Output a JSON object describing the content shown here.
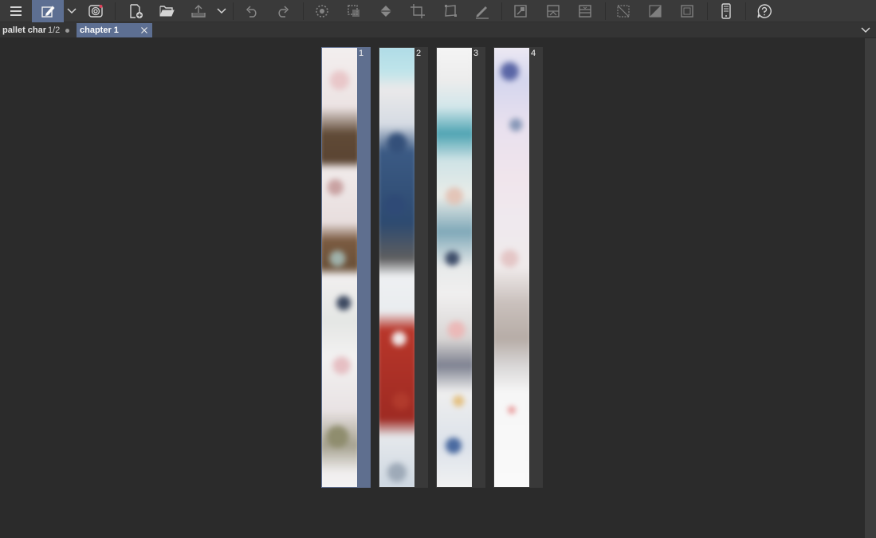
{
  "toolbar": {
    "buttons": [
      {
        "name": "menu-button",
        "icon": "hamburger-icon"
      },
      {
        "name": "edit-mode-button",
        "icon": "pencil-page-icon",
        "active": true
      },
      {
        "name": "edit-mode-dropdown",
        "icon": "chevron-down-icon"
      },
      {
        "name": "companion-button",
        "icon": "spiral-icon"
      },
      {
        "name": "new-page-button",
        "icon": "new-page-icon"
      },
      {
        "name": "open-button",
        "icon": "folder-open-icon"
      },
      {
        "name": "export-button",
        "icon": "export-tray-icon"
      },
      {
        "name": "export-dropdown",
        "icon": "chevron-down-icon"
      },
      {
        "name": "undo-button",
        "icon": "undo-icon"
      },
      {
        "name": "redo-button",
        "icon": "redo-icon"
      },
      {
        "name": "clear-selection-button",
        "icon": "dotted-circle-icon"
      },
      {
        "name": "lasso-button",
        "icon": "lasso-icon"
      },
      {
        "name": "fill-button",
        "icon": "fill-bucket-icon"
      },
      {
        "name": "crop-button",
        "icon": "crop-icon"
      },
      {
        "name": "transform-button",
        "icon": "transform-icon"
      },
      {
        "name": "draw-button",
        "icon": "pen-icon"
      },
      {
        "name": "adjust-1-button",
        "icon": "image-adjust-icon"
      },
      {
        "name": "adjust-2-button",
        "icon": "image-split-icon"
      },
      {
        "name": "adjust-3-button",
        "icon": "image-stack-icon"
      },
      {
        "name": "hide-selection-button",
        "icon": "grid-off-icon"
      },
      {
        "name": "tone-button",
        "icon": "tone-icon"
      },
      {
        "name": "frame-button",
        "icon": "frame-icon"
      },
      {
        "name": "device-button",
        "icon": "smartphone-icon"
      },
      {
        "name": "help-button",
        "icon": "help-bubble-icon"
      }
    ]
  },
  "tabs": [
    {
      "name": "pallet char",
      "pages": "1/2",
      "modified": true
    },
    {
      "name": "chapter 1",
      "active": true
    }
  ],
  "thumbnails": [
    {
      "number": "1",
      "selected": true
    },
    {
      "number": "2",
      "selected": false
    },
    {
      "number": "3",
      "selected": false
    },
    {
      "number": "4",
      "selected": false
    }
  ],
  "colors": {
    "accent": "#5d6f92",
    "toolbar": "#3a3a3a",
    "canvas": "#2b2b2b"
  }
}
